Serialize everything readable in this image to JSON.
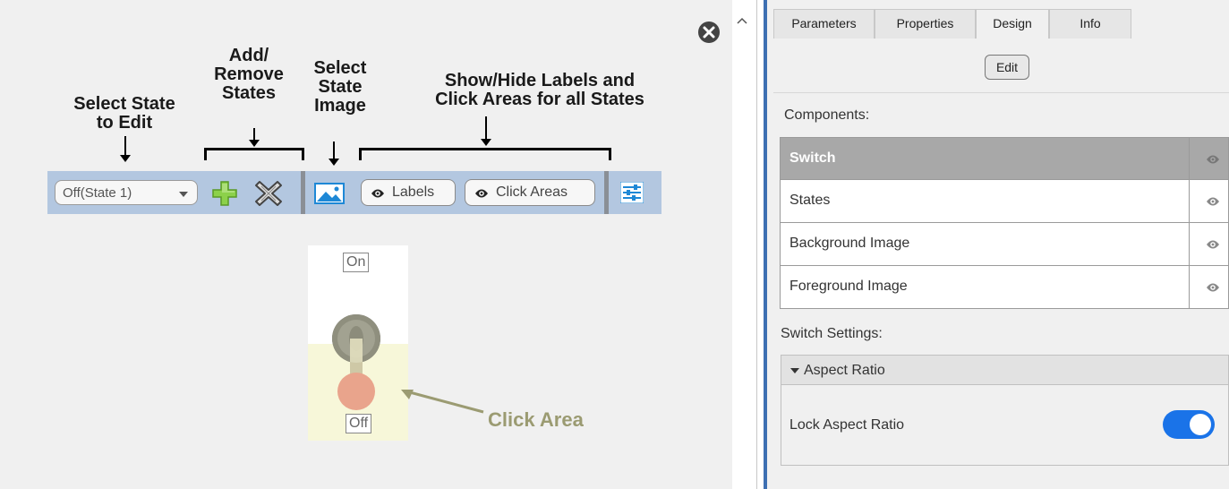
{
  "annotations": {
    "select_state": "Select State\nto Edit",
    "add_remove": "Add/\nRemove\nStates",
    "select_image": "Select\nState\nImage",
    "show_hide": "Show/Hide Labels and\nClick Areas for all States",
    "click_area": "Click Area"
  },
  "toolbar": {
    "state_select_value": "Off(State 1)",
    "labels_button": "Labels",
    "click_areas_button": "Click Areas"
  },
  "switch": {
    "on_label": "On",
    "off_label": "Off"
  },
  "tabs": [
    "Parameters",
    "Properties",
    "Design",
    "Info"
  ],
  "active_tab": "Design",
  "edit_button": "Edit",
  "components_label": "Components:",
  "components": [
    {
      "name": "Switch",
      "selected": true
    },
    {
      "name": "States",
      "selected": false
    },
    {
      "name": "Background Image",
      "selected": false
    },
    {
      "name": "Foreground Image",
      "selected": false
    }
  ],
  "switch_settings_label": "Switch Settings:",
  "aspect_ratio_header": "Aspect Ratio",
  "lock_aspect_ratio_label": "Lock Aspect Ratio",
  "lock_aspect_ratio_on": true,
  "colors": {
    "toolbar_bg": "#b3c7e0",
    "accent_blue": "#1a73e8",
    "click_area_fill": "#f7f7d9",
    "click_area_text": "#9b9b72",
    "selected_row": "#a8a8a8"
  },
  "icons": [
    "add-icon",
    "remove-icon",
    "image-icon",
    "eye-icon",
    "settings-sliders-icon",
    "close-icon",
    "collapse-icon"
  ]
}
